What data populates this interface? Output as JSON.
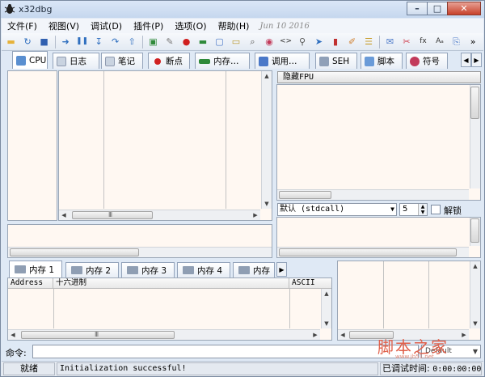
{
  "window": {
    "title": "x32dbg"
  },
  "menu": {
    "items": [
      "文件(F)",
      "视图(V)",
      "调试(D)",
      "插件(P)",
      "选项(O)",
      "帮助(H)"
    ],
    "date": "Jun 10 2016"
  },
  "toolbar": {
    "icons": [
      "open-icon",
      "restart-icon",
      "stop-icon",
      "run-icon",
      "pause-icon",
      "step-into-icon",
      "step-over-icon",
      "execute-till-return-icon",
      "script-icon",
      "notes-icon",
      "breakpoint-icon",
      "memory-icon",
      "threads-icon",
      "patch-icon",
      "search-icon",
      "references-icon",
      "source-icon",
      "find-icon",
      "trace-icon",
      "tracing-icon",
      "highlight-icon",
      "labels-icon",
      "comments-icon",
      "bookmarks-icon",
      "function-icon",
      "font-icon",
      "copy-icon"
    ],
    "overflow": "»"
  },
  "colors": {
    "pane_bg": "#fff8f2",
    "chrome": "#dfe9f5",
    "accent": "#c7412b"
  },
  "tabs": [
    {
      "label": "CPU",
      "active": true,
      "icon": "cpu-icon",
      "color": "#5a8fd0"
    },
    {
      "label": "日志",
      "icon": "log-icon",
      "color": "#c9d3e0"
    },
    {
      "label": "笔记",
      "icon": "notes-icon",
      "color": "#c9d3e0"
    },
    {
      "label": "断点",
      "icon": "breakpoint-icon",
      "color": "#d02020"
    },
    {
      "label": "内存…",
      "icon": "memory-icon",
      "color": "#2f8a3a"
    },
    {
      "label": "调用…",
      "icon": "callstack-icon",
      "color": "#4a78c8"
    },
    {
      "label": "SEH",
      "icon": "seh-icon",
      "color": "#8fa0b8"
    },
    {
      "label": "脚本",
      "icon": "script-icon",
      "color": "#6a9bd8"
    },
    {
      "label": "符号",
      "icon": "symbols-icon",
      "color": "#c23a5a"
    }
  ],
  "tab_scroll": {
    "left": "◀",
    "right": "▶"
  },
  "fpu": {
    "label": "隐藏FPU"
  },
  "callconv": {
    "value": "默认 (stdcall)",
    "arrow": "▼"
  },
  "arg_count": {
    "value": "5",
    "arrows": "▲▼"
  },
  "unlock": {
    "label": "解锁"
  },
  "memory_tabs": [
    {
      "label": "内存 1",
      "active": true
    },
    {
      "label": "内存 2"
    },
    {
      "label": "内存 3"
    },
    {
      "label": "内存 4"
    },
    {
      "label": "内存"
    }
  ],
  "memory_tab_scroll": "▶",
  "dump_columns": [
    "Address",
    "十六进制",
    "ASCII"
  ],
  "command": {
    "label": "命令:",
    "selector": "Default",
    "arrow": "▼"
  },
  "status": {
    "state": "就绪",
    "message": "Initialization successful!",
    "time_label": "已调试时间:",
    "time_value": "0:00:00:00"
  },
  "watermark": {
    "text": "脚本之家",
    "url": "www.jb51.net"
  },
  "scroll": {
    "grip": "III",
    "up": "▲",
    "down": "▼",
    "left": "◀",
    "right": "▶"
  }
}
